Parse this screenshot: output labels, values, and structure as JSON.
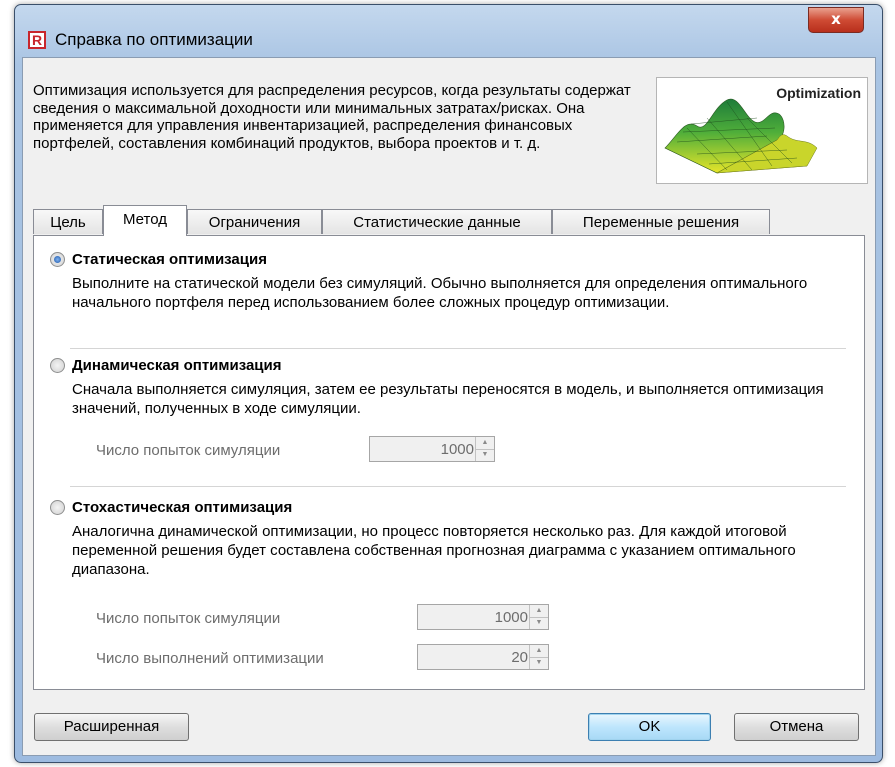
{
  "window": {
    "title": "Справка по оптимизации",
    "app_icon": "R",
    "close_label": "x"
  },
  "description": "Оптимизация используется для распределения ресурсов, когда результаты содержат сведения о максимальной доходности или минимальных затратах/рисках. Она применяется для управления инвентаризацией, распределения финансовых портфелей, составления комбинаций продуктов, выбора проектов и т. д.",
  "logo": {
    "text": "Optimization",
    "icon": "3d-surface-graphic"
  },
  "tabs": [
    {
      "label": "Цель",
      "active": false
    },
    {
      "label": "Метод",
      "active": true
    },
    {
      "label": "Ограничения",
      "active": false
    },
    {
      "label": "Статистические данные",
      "active": false
    },
    {
      "label": "Переменные решения",
      "active": false
    }
  ],
  "options": {
    "static": {
      "title": "Статическая оптимизация",
      "selected": true,
      "description": "Выполните на статической модели без симуляций. Обычно выполняется для определения оптимального начального портфеля перед использованием более сложных процедур оптимизации."
    },
    "dynamic": {
      "title": "Динамическая оптимизация",
      "selected": false,
      "description": "Сначала выполняется симуляция, затем ее результаты переносятся в модель, и выполняется оптимизация значений, полученных в ходе симуляции.",
      "trials_label": "Число попыток симуляции",
      "trials_value": "1000"
    },
    "stochastic": {
      "title": "Стохастическая оптимизация",
      "selected": false,
      "description": "Аналогична динамической оптимизации, но процесс повторяется несколько раз. Для каждой итоговой переменной решения будет составлена собственная прогнозная диаграмма с указанием оптимального диапазона.",
      "trials_label": "Число попыток симуляции",
      "trials_value": "1000",
      "runs_label": "Число выполнений оптимизации",
      "runs_value": "20"
    }
  },
  "buttons": {
    "advanced": "Расширенная",
    "ok": "OK",
    "cancel": "Отмена"
  },
  "colors": {
    "selected_radio": "#1c55a8",
    "close_button": "#cf4b34",
    "title_bar": "#a9c4e3"
  }
}
